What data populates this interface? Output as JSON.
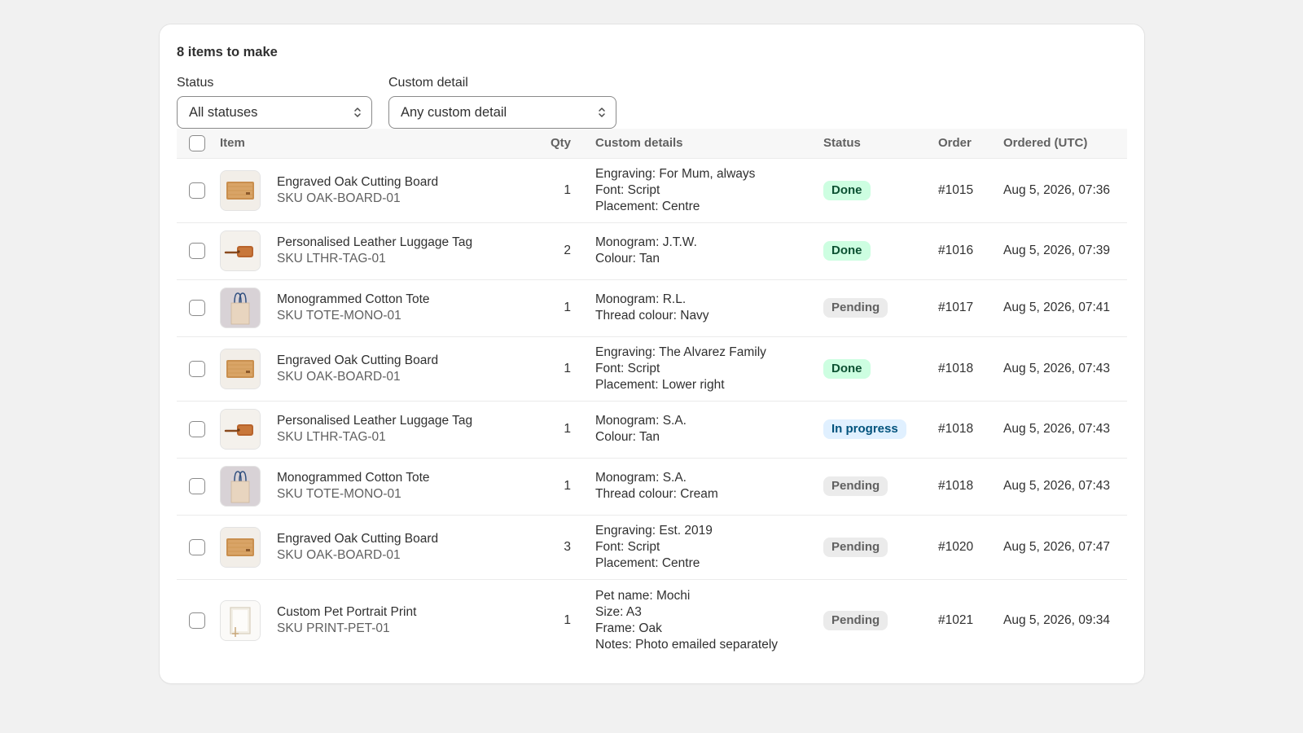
{
  "heading": "8 items to make",
  "filters": {
    "status": {
      "label": "Status",
      "value": "All statuses"
    },
    "custom": {
      "label": "Custom detail",
      "value": "Any custom detail"
    }
  },
  "columns": {
    "item": "Item",
    "qty": "Qty",
    "details": "Custom details",
    "status": "Status",
    "order": "Order",
    "ordered": "Ordered (UTC)"
  },
  "rows": [
    {
      "thumb": "board",
      "name": "Engraved Oak Cutting Board",
      "sku": "SKU OAK-BOARD-01",
      "qty": "1",
      "details": [
        "Engraving: For Mum, always",
        "Font: Script",
        "Placement: Centre"
      ],
      "status": "Done",
      "status_kind": "done",
      "order": "#1015",
      "ordered": "Aug 5, 2026, 07:36"
    },
    {
      "thumb": "tag",
      "name": "Personalised Leather Luggage Tag",
      "sku": "SKU LTHR-TAG-01",
      "qty": "2",
      "details": [
        "Monogram: J.T.W.",
        "Colour: Tan"
      ],
      "status": "Done",
      "status_kind": "done",
      "order": "#1016",
      "ordered": "Aug 5, 2026, 07:39"
    },
    {
      "thumb": "tote",
      "name": "Monogrammed Cotton Tote",
      "sku": "SKU TOTE-MONO-01",
      "qty": "1",
      "details": [
        "Monogram: R.L.",
        "Thread colour: Navy"
      ],
      "status": "Pending",
      "status_kind": "pending",
      "order": "#1017",
      "ordered": "Aug 5, 2026, 07:41"
    },
    {
      "thumb": "board",
      "name": "Engraved Oak Cutting Board",
      "sku": "SKU OAK-BOARD-01",
      "qty": "1",
      "details": [
        "Engraving: The Alvarez Family",
        "Font: Script",
        "Placement: Lower right"
      ],
      "status": "Done",
      "status_kind": "done",
      "order": "#1018",
      "ordered": "Aug 5, 2026, 07:43"
    },
    {
      "thumb": "tag",
      "name": "Personalised Leather Luggage Tag",
      "sku": "SKU LTHR-TAG-01",
      "qty": "1",
      "details": [
        "Monogram: S.A.",
        "Colour: Tan"
      ],
      "status": "In progress",
      "status_kind": "progress",
      "order": "#1018",
      "ordered": "Aug 5, 2026, 07:43"
    },
    {
      "thumb": "tote",
      "name": "Monogrammed Cotton Tote",
      "sku": "SKU TOTE-MONO-01",
      "qty": "1",
      "details": [
        "Monogram: S.A.",
        "Thread colour: Cream"
      ],
      "status": "Pending",
      "status_kind": "pending",
      "order": "#1018",
      "ordered": "Aug 5, 2026, 07:43"
    },
    {
      "thumb": "board",
      "name": "Engraved Oak Cutting Board",
      "sku": "SKU OAK-BOARD-01",
      "qty": "3",
      "details": [
        "Engraving: Est. 2019",
        "Font: Script",
        "Placement: Centre"
      ],
      "status": "Pending",
      "status_kind": "pending",
      "order": "#1020",
      "ordered": "Aug 5, 2026, 07:47"
    },
    {
      "thumb": "print",
      "name": "Custom Pet Portrait Print",
      "sku": "SKU PRINT-PET-01",
      "qty": "1",
      "details": [
        "Pet name: Mochi",
        "Size: A3",
        "Frame: Oak",
        "Notes: Photo emailed separately"
      ],
      "status": "Pending",
      "status_kind": "pending",
      "order": "#1021",
      "ordered": "Aug 5, 2026, 09:34"
    }
  ]
}
